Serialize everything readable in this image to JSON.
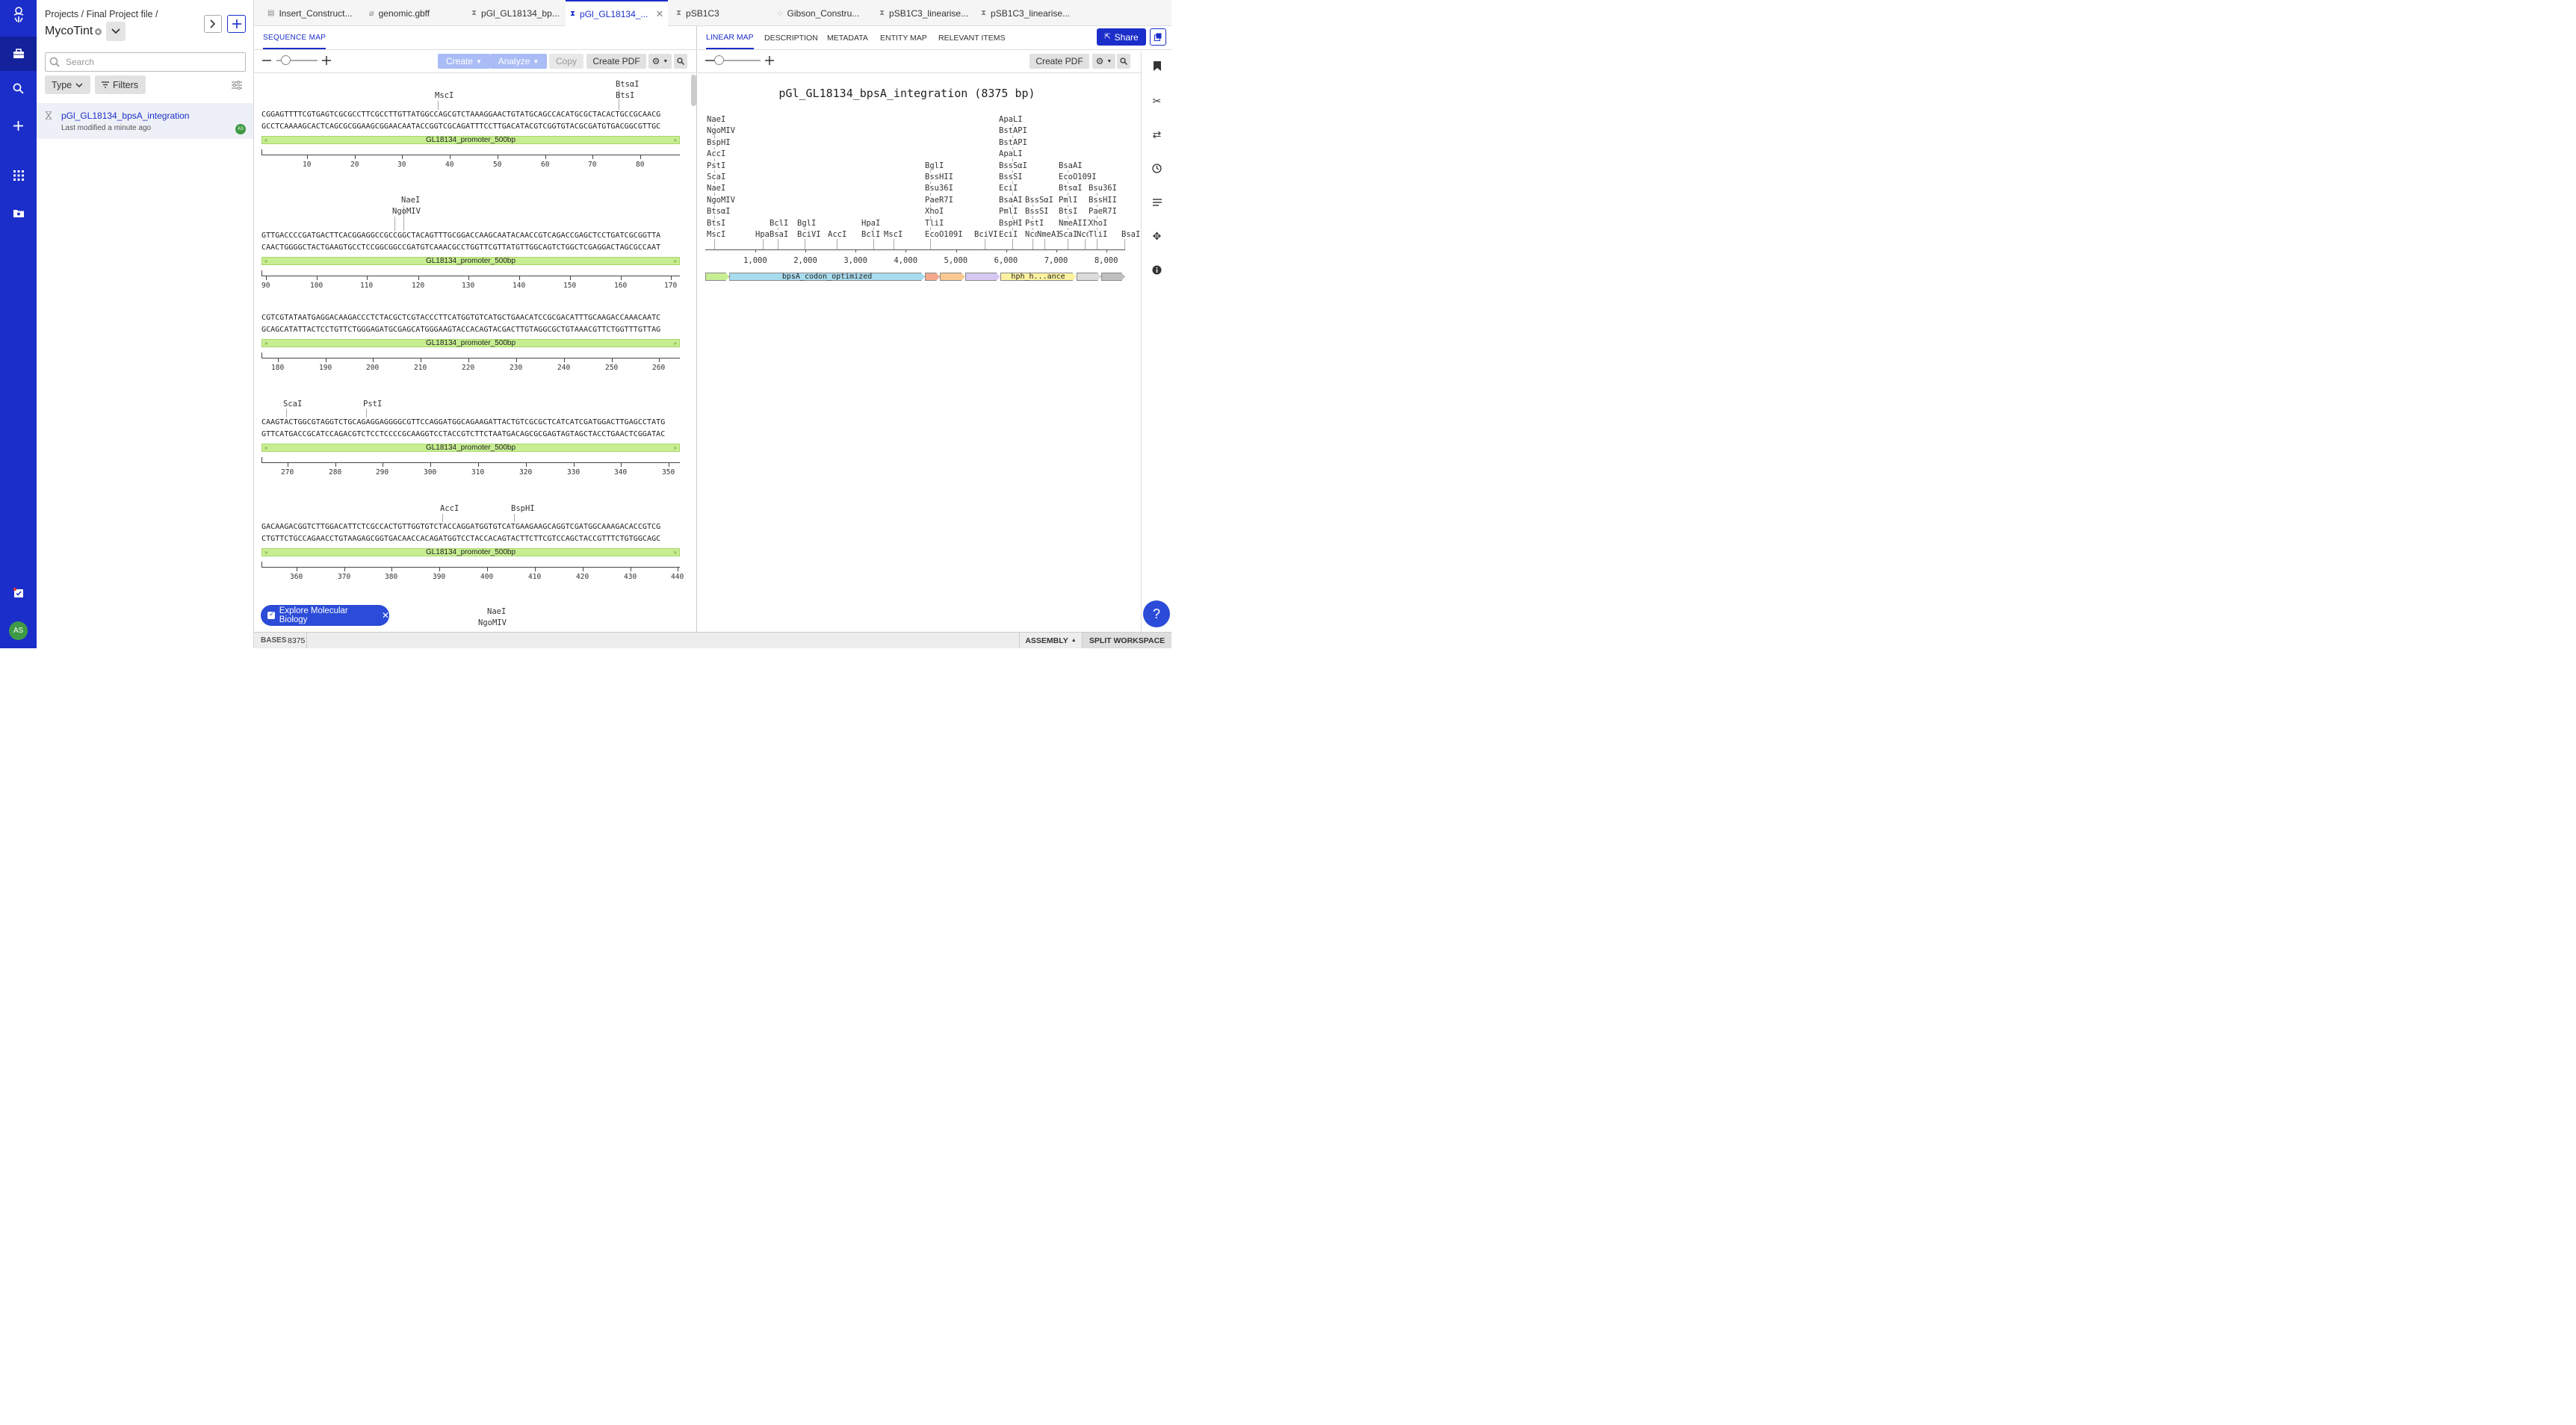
{
  "breadcrumb": "Projects / Final Project file /",
  "project_title": "MycoTint",
  "search_placeholder": "Search",
  "type_label": "Type",
  "filters_label": "Filters",
  "entry": {
    "name": "pGl_GL18134_bpsA_integration",
    "modified": "Last modified a minute ago",
    "avatar": "AS"
  },
  "user_initials": "AS",
  "tabs": [
    {
      "label": "Insert_Construct..."
    },
    {
      "label": "genomic.gbff"
    },
    {
      "label": "pGl_GL18134_bp..."
    },
    {
      "label": "pGl_GL18134_..."
    },
    {
      "label": "pSB1C3"
    },
    {
      "label": "Gibson_Constru..."
    },
    {
      "label": "pSB1C3_linearise..."
    },
    {
      "label": "pSB1C3_linearise..."
    }
  ],
  "left_pane": {
    "subtab": "SEQUENCE MAP",
    "create": "Create",
    "analyze": "Analyze",
    "copy": "Copy",
    "create_pdf": "Create PDF"
  },
  "sequence_rows": [
    {
      "top": "CGGAGTTTTCGTGAGTCGCGCCTTCGCCTTGTTATGGCCAGCGTCTAAAGGAACTGTATGCAGCCACATGCGCTACACTGCCGCAACG",
      "bottom": "GCCTCAAAAGCACTCAGCGCGGAAGCGGAACAATACCGGTCGCAGATTTCCTTGACATACGTCGGTGTACGCGATGTGACGGCGTTGC",
      "feature": "GL18134_promoter_500bp",
      "ticks": [
        "10",
        "20",
        "30",
        "40",
        "50",
        "60",
        "70",
        "80"
      ],
      "enzymes": [
        {
          "name": "MscI",
          "row": 1
        },
        {
          "name": "BtsαI",
          "row": 0
        },
        {
          "name": "BtsI",
          "row": 1
        }
      ]
    },
    {
      "top": "GTTGACCCCGATGACTTCACGGAGGCCGCCGGCTACAGTTTGCGGACCAAGCAATACAACCGTCAGACCGAGCTCCTGATCGCGGTTA",
      "bottom": "CAACTGGGGCTACTGAAGTGCCTCCGGCGGCCGATGTCAAACGCCTGGTTCGTTATGTTGGCAGTCTGGCTCGAGGACTAGCGCCAAT",
      "feature": "GL18134_promoter_500bp",
      "ticks": [
        "90",
        "100",
        "110",
        "120",
        "130",
        "140",
        "150",
        "160",
        "170"
      ],
      "enzymes": [
        {
          "name": "NaeI",
          "row": 0
        },
        {
          "name": "NgoMIV",
          "row": 1
        }
      ]
    },
    {
      "top": "CGTCGTATAATGAGGACAAGACCCTCTACGCTCGTACCCTTCATGGTGTCATGCTGAACATCCGCGACATTTGCAAGACCAAACAATC",
      "bottom": "GCAGCATATTACTCCTGTTCTGGGAGATGCGAGCATGGGAAGTACCACAGTACGACTTGTAGGCGCTGTAAACGTTCTGGTTTGTTAG",
      "feature": "GL18134_promoter_500bp",
      "ticks": [
        "180",
        "190",
        "200",
        "210",
        "220",
        "230",
        "240",
        "250",
        "260"
      ],
      "enzymes": []
    },
    {
      "top": "CAAGTACTGGCGTAGGTCTGCAGAGGAGGGGCGTTCCAGGATGGCAGAAGATTACTGTCGCGCTCATCATCGATGGACTTGAGCCTATG",
      "bottom": "GTTCATGACCGCATCCAGACGTCTCCTCCCCGCAAGGTCCTACCGTCTTCTAATGACAGCGCGAGTAGTAGCTACCTGAACTCGGATAC",
      "feature": "GL18134_promoter_500bp",
      "ticks": [
        "270",
        "280",
        "290",
        "300",
        "310",
        "320",
        "330",
        "340",
        "350"
      ],
      "enzymes": [
        {
          "name": "ScaI",
          "row": 0
        },
        {
          "name": "PstI",
          "row": 0
        }
      ]
    },
    {
      "top": "GACAAGACGGTCTTGGACATTCTCGCCACTGTTGGTGTCTACCAGGATGGTGTCATGAAGAAGCAGGTCGATGGCAAAGACACCGTCG",
      "bottom": "CTGTTCTGCCAGAACCTGTAAGAGCGGTGACAACCACAGATGGTCCTACCACAGTACTTCTTCGTCCAGCTACCGTTTCTGTGGCAGC",
      "feature": "GL18134_promoter_500bp",
      "ticks": [
        "360",
        "370",
        "380",
        "390",
        "400",
        "410",
        "420",
        "430",
        "440"
      ],
      "enzymes": [
        {
          "name": "AccI",
          "row": 0
        },
        {
          "name": "BspHI",
          "row": 0
        }
      ]
    }
  ],
  "partial_enzymes": [
    "NaeI",
    "NgoMIV"
  ],
  "explore_label": "Explore Molecular Biology",
  "status": {
    "bases_label": "BASES",
    "bases_value": "8375",
    "assembly": "ASSEMBLY",
    "split": "SPLIT WORKSPACE"
  },
  "right_pane": {
    "tabs": [
      "LINEAR MAP",
      "DESCRIPTION",
      "METADATA",
      "ENTITY MAP",
      "RELEVANT ITEMS"
    ],
    "share": "Share",
    "create_pdf": "Create PDF",
    "map_title": "pGl_GL18134_bpsA_integration (8375 bp)",
    "axis_ticks": [
      "1,000",
      "2,000",
      "3,000",
      "4,000",
      "5,000",
      "6,000",
      "7,000",
      "8,000"
    ],
    "features": [
      {
        "label": ""
      },
      {
        "label": "bpsA_codon_optimized"
      },
      {
        "label": ""
      },
      {
        "label": ""
      },
      {
        "label": ""
      },
      {
        "label": "hph_h...ance"
      },
      {
        "label": ""
      },
      {
        "label": ""
      }
    ],
    "enzyme_groups": [
      [
        "MscI",
        "BtsI",
        "BtsαI",
        "NgoMIV",
        "NaeI",
        "ScaI",
        "PstI",
        "AccI",
        "BspHI",
        "NgoMIV",
        "NaeI"
      ],
      [
        "HpaI"
      ],
      [
        "BsaI",
        "BclI"
      ],
      [
        "BciVI",
        "BglI"
      ],
      [
        "AccI"
      ],
      [
        "BclI",
        "HpaI"
      ],
      [
        "MscI"
      ],
      [
        "EcoO109I",
        "TliI",
        "XhoI",
        "PaeR7I",
        "Bsu36I",
        "BssHII",
        "BglI"
      ],
      [
        "BciVI"
      ],
      [
        "EciI",
        "BspHI",
        "PmlI",
        "BsaAI",
        "EciI",
        "BssSI",
        "BssSαI",
        "ApaLI",
        "BstAPI",
        "BstAPI",
        "ApaLI"
      ],
      [
        "NcoI",
        "PstI",
        "BssSI",
        "BssSαI"
      ],
      [
        "NmeAIII"
      ],
      [
        "ScaI",
        "NmeAIII",
        "BtsI",
        "PmlI",
        "BtsαI",
        "EcoO109I",
        "BsaAI"
      ],
      [
        "NcoI"
      ],
      [
        "TliI",
        "XhoI",
        "PaeR7I",
        "BssHII",
        "Bsu36I"
      ],
      [
        "BsaI"
      ]
    ]
  },
  "colors": {
    "nav": "#1b2ec9",
    "feature_green": "#c7ee92",
    "bpsA_blue": "#a8dcef",
    "hph_yellow": "#fcf2a0"
  }
}
